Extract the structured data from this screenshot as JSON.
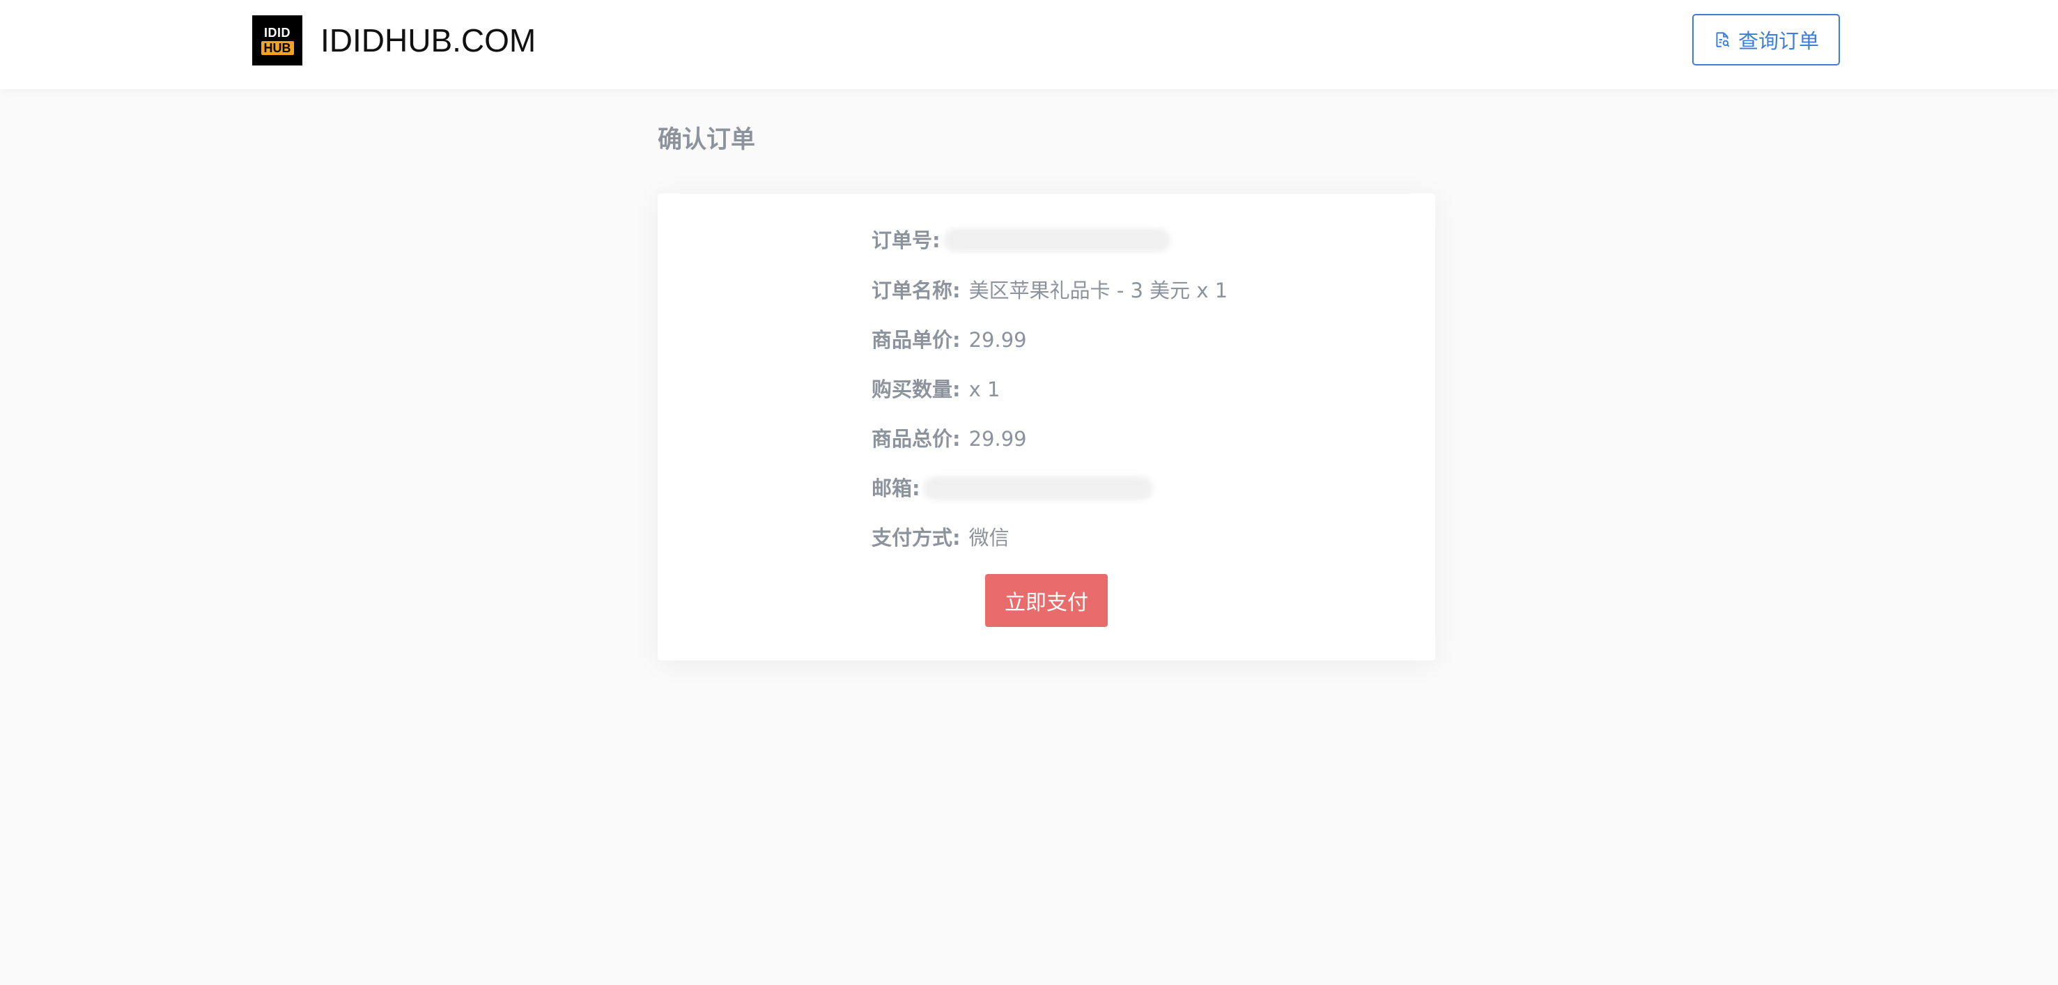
{
  "header": {
    "logo_top": "IDID",
    "logo_bottom": "HUB",
    "brand": "IDIDHUB.COM",
    "query_button": "查询订单"
  },
  "page_title": "确认订单",
  "order": {
    "order_no_label": "订单号:",
    "order_name_label": "订单名称:",
    "order_name": "美区苹果礼品卡 - 3 美元 x 1",
    "unit_price_label": "商品单价:",
    "unit_price": "29.99",
    "quantity_label": "购买数量:",
    "quantity": "x 1",
    "total_label": "商品总价:",
    "total": "29.99",
    "email_label": "邮箱:",
    "payment_label": "支付方式:",
    "payment": "微信"
  },
  "pay_button": "立即支付",
  "colors": {
    "accent": "#3b7ddd",
    "pay": "#e96c6c",
    "logo_orange": "#f7a21b",
    "text_muted": "#8d939c",
    "background": "#fafafa"
  },
  "icons": {
    "query_button_icon": "document-search-icon"
  }
}
